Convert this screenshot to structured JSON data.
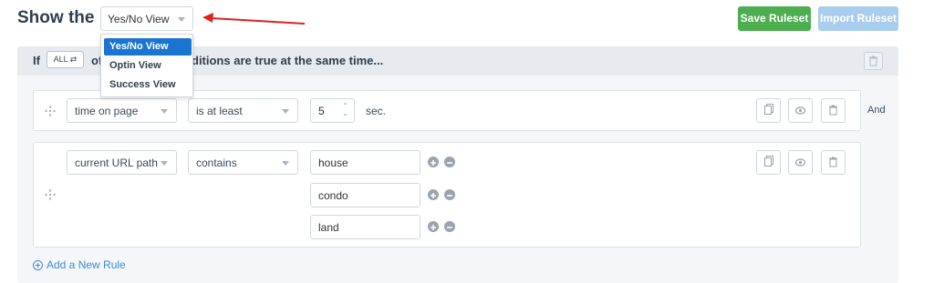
{
  "header": {
    "show_label": "Show the",
    "view_select_value": "Yes/No View",
    "save_button": "Save Ruleset",
    "import_button": "Import Ruleset"
  },
  "dropdown": {
    "options": [
      "Yes/No View",
      "Optin View",
      "Success View"
    ],
    "selected_index": 0
  },
  "panel": {
    "if_label": "If",
    "all_toggle": "ALL ⇄",
    "header_text_left": "of",
    "header_text_right": "ditions are true at the same time..."
  },
  "rules": [
    {
      "condition": "time on page",
      "operator": "is at least",
      "value": "5",
      "unit": "sec.",
      "connector": "And"
    },
    {
      "condition": "current URL path",
      "operator": "contains",
      "values": [
        "house",
        "condo",
        "land"
      ]
    }
  ],
  "footer": {
    "add_rule": "Add a New Rule"
  },
  "colors": {
    "save": "#4cae4f",
    "import": "#a8cdee",
    "link": "#3f8bd1",
    "menu_active": "#1a75d2",
    "arrow": "#e02020"
  }
}
